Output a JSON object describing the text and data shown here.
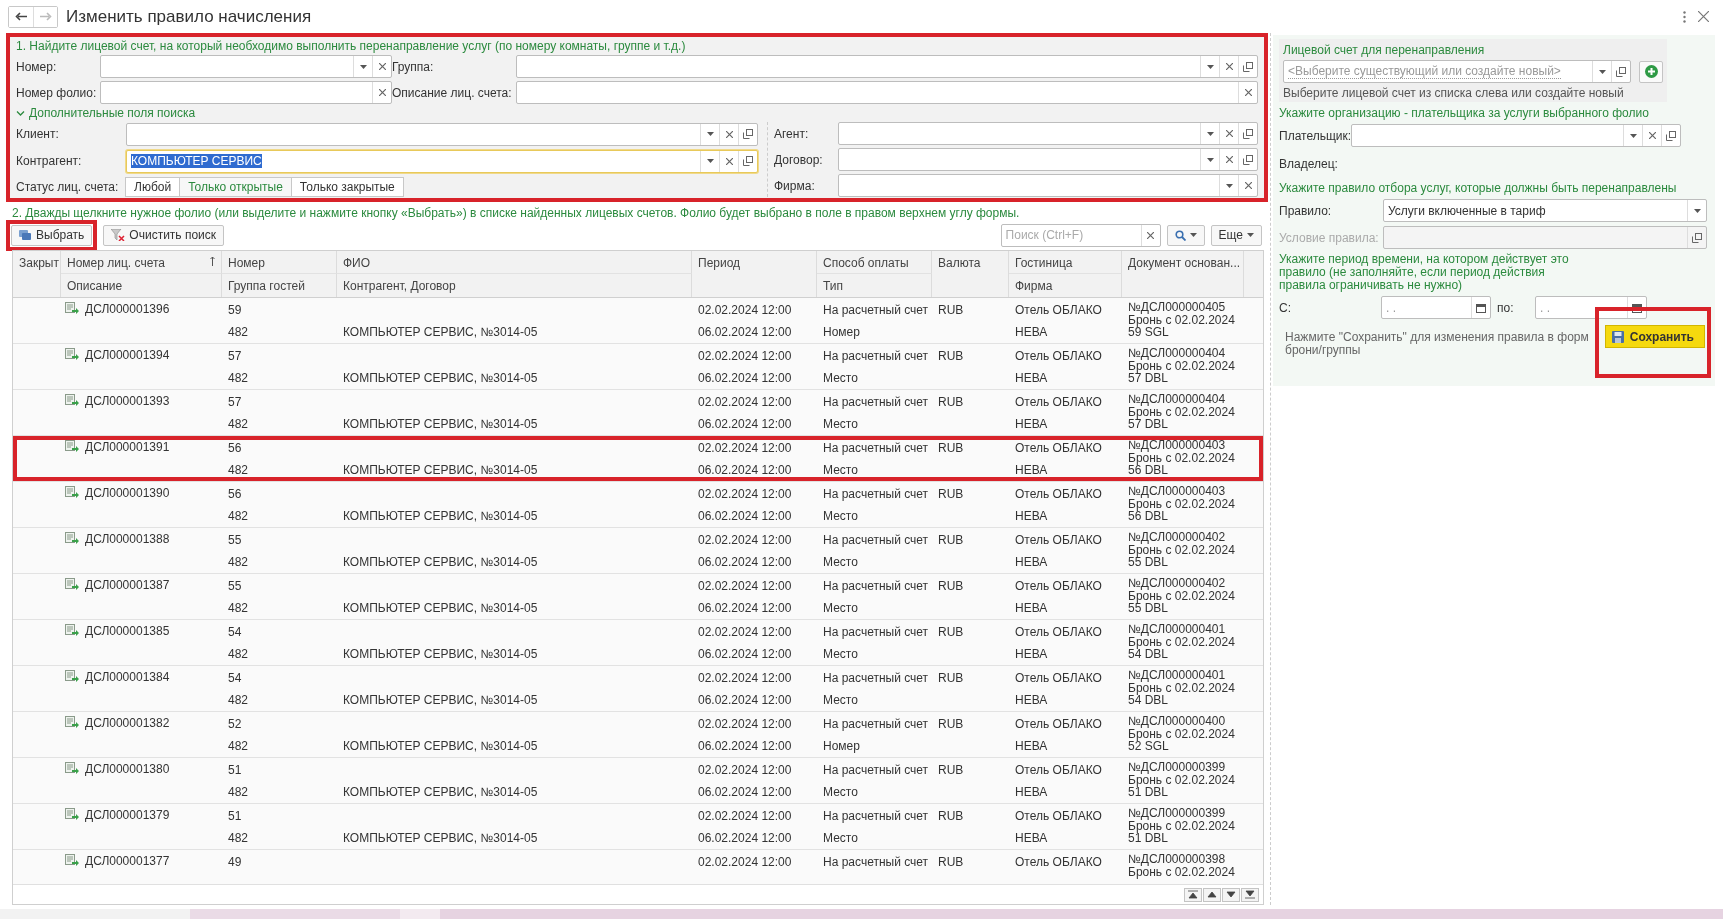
{
  "window": {
    "title": "Изменить правило начисления"
  },
  "search": {
    "highlighted": true,
    "heading": "1. Найдите лицевой счет, на который необходимо выполнить перенаправление услуг (по номеру комнаты, группе и т.д.)",
    "top_fields": [
      {
        "label": "Номер:",
        "dropdown": true,
        "clear": true,
        "focused": false
      },
      {
        "label": "Группа:",
        "dropdown": true,
        "clear": true,
        "open": true,
        "focused": false
      },
      {
        "label": "Номер фолио:",
        "clear": true,
        "focused": false
      },
      {
        "label": "Описание лиц. счета:",
        "clear": true,
        "focused": false
      }
    ],
    "more": {
      "label": "Дополнительные поля поиска",
      "expanded": true
    },
    "left_fields": [
      {
        "label": "Клиент:",
        "dropdown": true,
        "clear": true,
        "open": true,
        "focused": false
      },
      {
        "label": "Контрагент:",
        "value": "КОМПЬЮТЕР СЕРВИС",
        "value_selected": true,
        "dropdown": true,
        "clear": true,
        "open": true,
        "focused": true
      }
    ],
    "status": {
      "label": "Статус лиц. счета:",
      "options": [
        {
          "label": "Любой",
          "selected": false
        },
        {
          "label": "Только открытые",
          "selected": true
        },
        {
          "label": "Только закрытые",
          "selected": false
        }
      ]
    },
    "right_fields": [
      {
        "label": "Агент:",
        "dropdown": true,
        "clear": true,
        "open": true,
        "focused": false
      },
      {
        "label": "Договор:",
        "dropdown": true,
        "clear": true,
        "open": true,
        "focused": false
      },
      {
        "label": "Фирма:",
        "dropdown": true,
        "clear": true,
        "focused": false
      }
    ]
  },
  "step2": "2. Дважды щелкните нужное фолио (или выделите и нажмите кнопку «Выбрать») в списке найденных лицевых счетов. Фолио будет выбрано в поле в правом верхнем углу формы.",
  "toolbar": {
    "select": {
      "label": "Выбрать",
      "highlighted": true
    },
    "clear": "Очистить поиск",
    "search_placeholder": "Поиск (Ctrl+F)",
    "more": "Еще"
  },
  "table": {
    "columns": [
      {
        "label": "Закрыт"
      },
      {
        "label": "Номер лиц. счета",
        "sub": "Описание",
        "sorted_ascending": true
      },
      {
        "label": "Номер",
        "sub": "Группа гостей"
      },
      {
        "label": "ФИО",
        "sub": "Контрагент, Договор"
      },
      {
        "label": "Период"
      },
      {
        "label": "Способ оплаты",
        "sub": "Тип"
      },
      {
        "label": "Валюта"
      },
      {
        "label": "Гостиница",
        "sub": "Фирма"
      },
      {
        "label": "Документ основан..."
      }
    ],
    "rows": [
      {
        "account": "ДСЛ000001396",
        "room": "59",
        "group": "482",
        "contract": "КОМПЬЮТЕР СЕРВИС, №3014-05",
        "from": "02.02.2024 12:00",
        "to": "06.02.2024 12:00",
        "payment": "На расчетный счет",
        "type": "Номер",
        "currency": "RUB",
        "hotel": "Отель ОБЛАКО",
        "firm": "НЕВА",
        "document": [
          "№ДСЛ000000405",
          "Бронь с 02.02.2024",
          "59 SGL"
        ],
        "highlighted": false
      },
      {
        "account": "ДСЛ000001394",
        "room": "57",
        "group": "482",
        "contract": "КОМПЬЮТЕР СЕРВИС, №3014-05",
        "from": "02.02.2024 12:00",
        "to": "06.02.2024 12:00",
        "payment": "На расчетный счет",
        "type": "Место",
        "currency": "RUB",
        "hotel": "Отель ОБЛАКО",
        "firm": "НЕВА",
        "document": [
          "№ДСЛ000000404",
          "Бронь с 02.02.2024",
          "57 DBL"
        ],
        "highlighted": false
      },
      {
        "account": "ДСЛ000001393",
        "room": "57",
        "group": "482",
        "contract": "КОМПЬЮТЕР СЕРВИС, №3014-05",
        "from": "02.02.2024 12:00",
        "to": "06.02.2024 12:00",
        "payment": "На расчетный счет",
        "type": "Место",
        "currency": "RUB",
        "hotel": "Отель ОБЛАКО",
        "firm": "НЕВА",
        "document": [
          "№ДСЛ000000404",
          "Бронь с 02.02.2024",
          "57 DBL"
        ],
        "highlighted": false
      },
      {
        "account": "ДСЛ000001391",
        "room": "56",
        "group": "482",
        "contract": "КОМПЬЮТЕР СЕРВИС, №3014-05",
        "from": "02.02.2024 12:00",
        "to": "06.02.2024 12:00",
        "payment": "На расчетный счет",
        "type": "Место",
        "currency": "RUB",
        "hotel": "Отель ОБЛАКО",
        "firm": "НЕВА",
        "document": [
          "№ДСЛ000000403",
          "Бронь с 02.02.2024",
          "56 DBL"
        ],
        "highlighted": true
      },
      {
        "account": "ДСЛ000001390",
        "room": "56",
        "group": "482",
        "contract": "КОМПЬЮТЕР СЕРВИС, №3014-05",
        "from": "02.02.2024 12:00",
        "to": "06.02.2024 12:00",
        "payment": "На расчетный счет",
        "type": "Место",
        "currency": "RUB",
        "hotel": "Отель ОБЛАКО",
        "firm": "НЕВА",
        "document": [
          "№ДСЛ000000403",
          "Бронь с 02.02.2024",
          "56 DBL"
        ],
        "highlighted": false
      },
      {
        "account": "ДСЛ000001388",
        "room": "55",
        "group": "482",
        "contract": "КОМПЬЮТЕР СЕРВИС, №3014-05",
        "from": "02.02.2024 12:00",
        "to": "06.02.2024 12:00",
        "payment": "На расчетный счет",
        "type": "Место",
        "currency": "RUB",
        "hotel": "Отель ОБЛАКО",
        "firm": "НЕВА",
        "document": [
          "№ДСЛ000000402",
          "Бронь с 02.02.2024",
          "55 DBL"
        ],
        "highlighted": false
      },
      {
        "account": "ДСЛ000001387",
        "room": "55",
        "group": "482",
        "contract": "КОМПЬЮТЕР СЕРВИС, №3014-05",
        "from": "02.02.2024 12:00",
        "to": "06.02.2024 12:00",
        "payment": "На расчетный счет",
        "type": "Место",
        "currency": "RUB",
        "hotel": "Отель ОБЛАКО",
        "firm": "НЕВА",
        "document": [
          "№ДСЛ000000402",
          "Бронь с 02.02.2024",
          "55 DBL"
        ],
        "highlighted": false
      },
      {
        "account": "ДСЛ000001385",
        "room": "54",
        "group": "482",
        "contract": "КОМПЬЮТЕР СЕРВИС, №3014-05",
        "from": "02.02.2024 12:00",
        "to": "06.02.2024 12:00",
        "payment": "На расчетный счет",
        "type": "Место",
        "currency": "RUB",
        "hotel": "Отель ОБЛАКО",
        "firm": "НЕВА",
        "document": [
          "№ДСЛ000000401",
          "Бронь с 02.02.2024",
          "54 DBL"
        ],
        "highlighted": false
      },
      {
        "account": "ДСЛ000001384",
        "room": "54",
        "group": "482",
        "contract": "КОМПЬЮТЕР СЕРВИС, №3014-05",
        "from": "02.02.2024 12:00",
        "to": "06.02.2024 12:00",
        "payment": "На расчетный счет",
        "type": "Место",
        "currency": "RUB",
        "hotel": "Отель ОБЛАКО",
        "firm": "НЕВА",
        "document": [
          "№ДСЛ000000401",
          "Бронь с 02.02.2024",
          "54 DBL"
        ],
        "highlighted": false
      },
      {
        "account": "ДСЛ000001382",
        "room": "52",
        "group": "482",
        "contract": "КОМПЬЮТЕР СЕРВИС, №3014-05",
        "from": "02.02.2024 12:00",
        "to": "06.02.2024 12:00",
        "payment": "На расчетный счет",
        "type": "Номер",
        "currency": "RUB",
        "hotel": "Отель ОБЛАКО",
        "firm": "НЕВА",
        "document": [
          "№ДСЛ000000400",
          "Бронь с 02.02.2024",
          "52 SGL"
        ],
        "highlighted": false
      },
      {
        "account": "ДСЛ000001380",
        "room": "51",
        "group": "482",
        "contract": "КОМПЬЮТЕР СЕРВИС, №3014-05",
        "from": "02.02.2024 12:00",
        "to": "06.02.2024 12:00",
        "payment": "На расчетный счет",
        "type": "Место",
        "currency": "RUB",
        "hotel": "Отель ОБЛАКО",
        "firm": "НЕВА",
        "document": [
          "№ДСЛ000000399",
          "Бронь с 02.02.2024",
          "51 DBL"
        ],
        "highlighted": false
      },
      {
        "account": "ДСЛ000001379",
        "room": "51",
        "group": "482",
        "contract": "КОМПЬЮТЕР СЕРВИС, №3014-05",
        "from": "02.02.2024 12:00",
        "to": "06.02.2024 12:00",
        "payment": "На расчетный счет",
        "type": "Место",
        "currency": "RUB",
        "hotel": "Отель ОБЛАКО",
        "firm": "НЕВА",
        "document": [
          "№ДСЛ000000399",
          "Бронь с 02.02.2024",
          "51 DBL"
        ],
        "highlighted": false
      },
      {
        "account": "ДСЛ000001377",
        "room": "49",
        "from": "02.02.2024 12:00",
        "payment": "На расчетный счет",
        "currency": "RUB",
        "hotel": "Отель ОБЛАКО",
        "document": [
          "№ДСЛ000000398",
          "Бронь с 02.02.2024"
        ],
        "highlighted": false
      }
    ]
  },
  "redirect": {
    "heading": "Лицевой счет для перенаправления",
    "placeholder": "<Выберите существующий или создайте новый>",
    "hint": "Выберите лицевой счет из списка слева или создайте новый",
    "payer_heading": "Укажите организацию - плательщика за услуги выбранного фолио",
    "payer_label": "Плательщик:",
    "owner_label": "Владелец:",
    "rule_heading": "Укажите правило отбора услуг, которые должны быть перенаправлены",
    "rule_label": "Правило:",
    "rule_value": "Услуги включенные в тариф",
    "condition_label": "Условие правила:",
    "condition_disabled": true,
    "period_heading": "Укажите период времени, на котором действует это правило (не заполняйте, если период действия правила ограничивать не нужно)",
    "from_label": "С:",
    "from_value": ". .",
    "to_label": "по:",
    "to_value": ". .",
    "note_lines": [
      "Нажмите \"Сохранить\" для изменения правила в форм",
      "брони/группы"
    ],
    "save": {
      "label": "Сохранить",
      "highlighted": true
    }
  }
}
